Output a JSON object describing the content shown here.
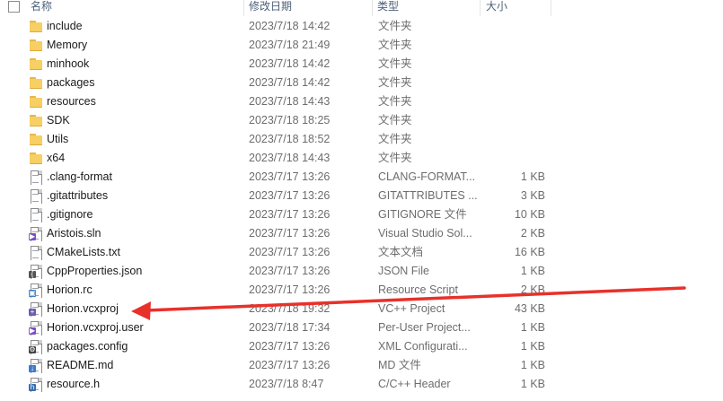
{
  "header": {
    "name": "名称",
    "date_modified": "修改日期",
    "type": "类型",
    "size": "大小"
  },
  "rows": [
    {
      "name": "include",
      "date": "2023/7/18 14:42",
      "type": "文件夹",
      "size": "",
      "icon": "folder-icon"
    },
    {
      "name": "Memory",
      "date": "2023/7/18 21:49",
      "type": "文件夹",
      "size": "",
      "icon": "folder-icon"
    },
    {
      "name": "minhook",
      "date": "2023/7/18 14:42",
      "type": "文件夹",
      "size": "",
      "icon": "folder-icon"
    },
    {
      "name": "packages",
      "date": "2023/7/18 14:42",
      "type": "文件夹",
      "size": "",
      "icon": "folder-icon"
    },
    {
      "name": "resources",
      "date": "2023/7/18 14:43",
      "type": "文件夹",
      "size": "",
      "icon": "folder-icon"
    },
    {
      "name": "SDK",
      "date": "2023/7/18 18:25",
      "type": "文件夹",
      "size": "",
      "icon": "folder-icon"
    },
    {
      "name": "Utils",
      "date": "2023/7/18 18:52",
      "type": "文件夹",
      "size": "",
      "icon": "folder-icon"
    },
    {
      "name": "x64",
      "date": "2023/7/18 14:43",
      "type": "文件夹",
      "size": "",
      "icon": "folder-icon"
    },
    {
      "name": ".clang-format",
      "date": "2023/7/17 13:26",
      "type": "CLANG-FORMAT...",
      "size": "1 KB",
      "icon": "file-icon"
    },
    {
      "name": ".gitattributes",
      "date": "2023/7/17 13:26",
      "type": "GITATTRIBUTES ...",
      "size": "3 KB",
      "icon": "file-icon"
    },
    {
      "name": ".gitignore",
      "date": "2023/7/17 13:26",
      "type": "GITIGNORE 文件",
      "size": "10 KB",
      "icon": "file-icon"
    },
    {
      "name": "Aristois.sln",
      "date": "2023/7/17 13:26",
      "type": "Visual Studio Sol...",
      "size": "2 KB",
      "icon": "visual-studio-solution-icon"
    },
    {
      "name": "CMakeLists.txt",
      "date": "2023/7/17 13:26",
      "type": "文本文档",
      "size": "16 KB",
      "icon": "text-document-icon"
    },
    {
      "name": "CppProperties.json",
      "date": "2023/7/17 13:26",
      "type": "JSON File",
      "size": "1 KB",
      "icon": "json-file-icon"
    },
    {
      "name": "Horion.rc",
      "date": "2023/7/17 13:26",
      "type": "Resource Script",
      "size": "2 KB",
      "icon": "resource-script-icon"
    },
    {
      "name": "Horion.vcxproj",
      "date": "2023/7/18 19:32",
      "type": "VC++ Project",
      "size": "43 KB",
      "icon": "vcxproj-icon"
    },
    {
      "name": "Horion.vcxproj.user",
      "date": "2023/7/18 17:34",
      "type": "Per-User Project...",
      "size": "1 KB",
      "icon": "vs-user-project-icon"
    },
    {
      "name": "packages.config",
      "date": "2023/7/17 13:26",
      "type": "XML Configurati...",
      "size": "1 KB",
      "icon": "config-file-icon"
    },
    {
      "name": "README.md",
      "date": "2023/7/17 13:26",
      "type": "MD 文件",
      "size": "1 KB",
      "icon": "markdown-file-icon"
    },
    {
      "name": "resource.h",
      "date": "2023/7/18 8:47",
      "type": "C/C++ Header",
      "size": "1 KB",
      "icon": "header-file-icon"
    }
  ],
  "colors": {
    "annotation_arrow": "#e8312a",
    "folder": "#f7cf62",
    "header_text": "#4c607a",
    "detail_text": "#6d6d6d"
  }
}
